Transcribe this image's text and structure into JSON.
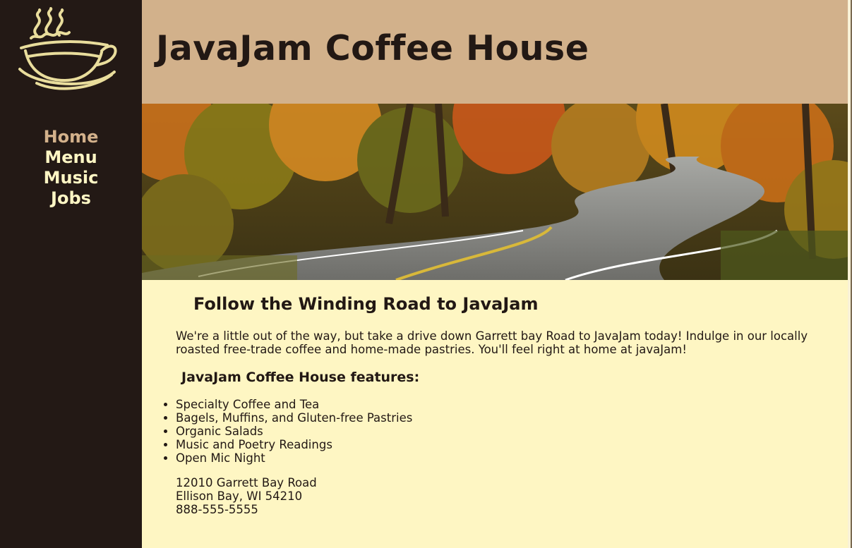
{
  "site": {
    "title": "JavaJam Coffee House"
  },
  "nav": {
    "items": [
      {
        "label": "Home",
        "active": true
      },
      {
        "label": "Menu",
        "active": false
      },
      {
        "label": "Music",
        "active": false
      },
      {
        "label": "Jobs",
        "active": false
      }
    ]
  },
  "hero": {
    "icon": "winding-road-photo"
  },
  "logo": {
    "icon": "coffee-cup-logo-icon"
  },
  "main": {
    "heading": "Follow the Winding Road to JavaJam",
    "intro": "We're a little out of the way, but take a drive down Garrett bay Road to JavaJam today! Indulge in our locally roasted free-trade coffee and home-made pastries. You'll feel right at home at javaJam!",
    "features_heading": "JavaJam Coffee House features:",
    "features": [
      "Specialty Coffee and Tea",
      "Bagels, Muffins, and Gluten-free Pastries",
      "Organic Salads",
      "Music and Poetry Readings",
      "Open Mic Night"
    ],
    "address": {
      "street": "12010 Garrett Bay Road",
      "city": "Ellison Bay, WI 54210",
      "phone": "888-555-5555"
    }
  },
  "colors": {
    "sidebar": "#231915",
    "header": "#d2b18b",
    "content": "#fef6c3",
    "nav_text": "#fef6c4",
    "nav_active": "#d3b18b"
  }
}
